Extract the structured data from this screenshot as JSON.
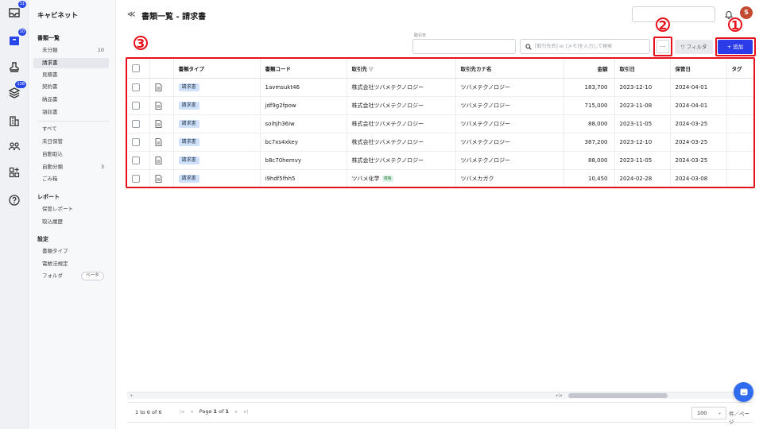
{
  "rail": {
    "items": [
      {
        "icon": "inbox-icon",
        "badge": "31"
      },
      {
        "icon": "cabinet-icon",
        "badge": "10"
      },
      {
        "icon": "stamp-icon",
        "badge": ""
      },
      {
        "icon": "layers-icon",
        "badge": "138"
      },
      {
        "icon": "building-icon",
        "badge": ""
      },
      {
        "icon": "users-icon",
        "badge": ""
      },
      {
        "icon": "apps-icon",
        "badge": ""
      },
      {
        "icon": "help-icon",
        "badge": ""
      }
    ]
  },
  "sidebar": {
    "title": "キャビネット",
    "section_docs": "書類一覧",
    "doc_items": [
      {
        "label": "未分類",
        "count": "10"
      },
      {
        "label": "請求書",
        "count": ""
      },
      {
        "label": "見積書",
        "count": ""
      },
      {
        "label": "契約書",
        "count": ""
      },
      {
        "label": "納品書",
        "count": ""
      },
      {
        "label": "領収書",
        "count": ""
      }
    ],
    "misc_items": [
      {
        "label": "すべて",
        "count": ""
      },
      {
        "label": "未日保管",
        "count": ""
      },
      {
        "label": "自動取込",
        "count": ""
      },
      {
        "label": "自動分類",
        "count": "3"
      },
      {
        "label": "ごみ箱",
        "count": ""
      }
    ],
    "section_report": "レポート",
    "report_items": [
      {
        "label": "保管レポート"
      },
      {
        "label": "取込履歴"
      }
    ],
    "section_settings": "設定",
    "settings_items": [
      {
        "label": "書類タイプ"
      },
      {
        "label": "電帳法規定"
      },
      {
        "label": "フォルダ",
        "pill": "ベータ"
      }
    ]
  },
  "header": {
    "back_icon": "≪",
    "title": "書類一覧 - 請求書",
    "avatar_initial": "S"
  },
  "toolbar": {
    "date_label": "取引日",
    "search_placeholder": "[取引先名] or [メモ]を入力して検索",
    "more_label": "...",
    "filter_label": "フィルタ",
    "add_label": "+ 追加"
  },
  "annotations": {
    "one": "1",
    "two": "2",
    "three": "3",
    "color": "#e8101a"
  },
  "table": {
    "columns": [
      "書類タイプ",
      "書類コード",
      "取引先 ▽",
      "取引先カナ名",
      "金額",
      "取引日",
      "保管日",
      "タグ"
    ],
    "rows": [
      {
        "type": "請求書",
        "code": "1avmsukt46",
        "partner": "株式会社ツバメテクノロジー",
        "kana": "ツバメテクノロジー",
        "amount": "183,700",
        "date": "2023-12-10",
        "stored": "2024-04-01",
        "tag": ""
      },
      {
        "type": "請求書",
        "code": "jdf9g2fpow",
        "partner": "株式会社ツバメテクノロジー",
        "kana": "ツバメテクノロジー",
        "amount": "715,000",
        "date": "2023-11-08",
        "stored": "2024-04-01",
        "tag": ""
      },
      {
        "type": "請求書",
        "code": "soihjh36iw",
        "partner": "株式会社ツバメテクノロジー",
        "kana": "ツバメテクノロジー",
        "amount": "88,000",
        "date": "2023-11-05",
        "stored": "2024-03-25",
        "tag": ""
      },
      {
        "type": "請求書",
        "code": "bc7xs4xkey",
        "partner": "株式会社ツバメテクノロジー",
        "kana": "ツバメテクノロジー",
        "amount": "387,200",
        "date": "2023-12-10",
        "stored": "2024-03-25",
        "tag": ""
      },
      {
        "type": "請求書",
        "code": "b8c70hemvy",
        "partner": "株式会社ツバメテクノロジー",
        "kana": "ツバメテクノロジー",
        "amount": "88,000",
        "date": "2023-11-05",
        "stored": "2024-03-25",
        "tag": ""
      },
      {
        "type": "請求書",
        "code": "i9hdf5fhh5",
        "partner": "ツバメ化学",
        "partner_tag": "適格",
        "kana": "ツバメカガク",
        "amount": "10,450",
        "date": "2024-02-28",
        "stored": "2024-03-08",
        "tag": ""
      }
    ]
  },
  "pager": {
    "count": "1 to 6 of 6",
    "page_prefix": "Page",
    "page_num": "1",
    "page_of": "of",
    "page_total": "1",
    "per_page": "100",
    "per_page_unit": "件／ページ"
  }
}
